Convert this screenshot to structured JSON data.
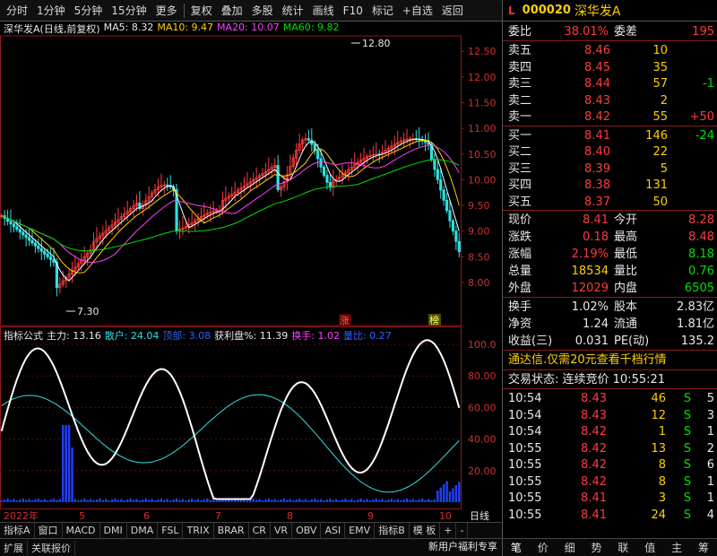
{
  "toolbar": {
    "items": [
      "分时",
      "1分钟",
      "5分钟",
      "15分钟",
      "更多",
      "复权",
      "叠加",
      "多股",
      "统计",
      "画线",
      "F10",
      "标记",
      "+自选",
      "返回"
    ]
  },
  "stock": {
    "flag": "L",
    "code": "000020",
    "name": "深华发A"
  },
  "main_legend": {
    "title": "深华发A(日线,前复权)",
    "ma5": "MA5: 8.32",
    "ma10": "MA10: 9.47",
    "ma20": "MA20: 10.07",
    "ma60": "MA60: 9.82"
  },
  "main_axis": {
    "labels": [
      "12.50",
      "12.00",
      "11.50",
      "11.00",
      "10.50",
      "10.00",
      "9.50",
      "9.00",
      "8.50",
      "8.00"
    ]
  },
  "annotations": {
    "high": "12.80",
    "low": "7.30",
    "tag1": "涨",
    "tag2": "榜"
  },
  "ind_legend": {
    "title": "指标公式",
    "zhuli": "主力: 13.16",
    "sanhu": "散户: 24.04",
    "dingbu": "顶部: 3.08",
    "huolipan": "获利盘%: 11.39",
    "huanshou": "换手: 1.02",
    "liangbi": "量比: 0.27"
  },
  "ind_axis": {
    "labels": [
      "100.0",
      "80.00",
      "60.00",
      "40.00",
      "20.00"
    ]
  },
  "xaxis": {
    "labels": [
      "2022年",
      "5",
      "6",
      "7",
      "8",
      "9",
      "10"
    ],
    "right": "日线"
  },
  "bottom_tabs": [
    "指标A",
    "窗口",
    "MACD",
    "DMI",
    "DMA",
    "FSL",
    "TRIX",
    "BRAR",
    "CR",
    "VR",
    "OBV",
    "ASI",
    "EMV",
    "指标B",
    "模 板",
    "+",
    "-"
  ],
  "bottom_bar": [
    "扩展",
    "关联报价"
  ],
  "quote": {
    "weibi_label": "委比",
    "weibi": "38.01%",
    "weicha_label": "委差",
    "weicha": "195",
    "asks": [
      {
        "label": "卖五",
        "price": "8.46",
        "vol": "10",
        "chg": ""
      },
      {
        "label": "卖四",
        "price": "8.45",
        "vol": "35",
        "chg": ""
      },
      {
        "label": "卖三",
        "price": "8.44",
        "vol": "57",
        "chg": "-1"
      },
      {
        "label": "卖二",
        "price": "8.43",
        "vol": "2",
        "chg": ""
      },
      {
        "label": "卖一",
        "price": "8.42",
        "vol": "55",
        "chg": "+50"
      }
    ],
    "bids": [
      {
        "label": "买一",
        "price": "8.41",
        "vol": "146",
        "chg": "-24"
      },
      {
        "label": "买二",
        "price": "8.40",
        "vol": "22",
        "chg": ""
      },
      {
        "label": "买三",
        "price": "8.39",
        "vol": "5",
        "chg": ""
      },
      {
        "label": "买四",
        "price": "8.38",
        "vol": "131",
        "chg": ""
      },
      {
        "label": "买五",
        "price": "8.37",
        "vol": "50",
        "chg": ""
      }
    ],
    "stats": [
      {
        "l1": "现价",
        "v1": "8.41",
        "l2": "今开",
        "v2": "8.28",
        "c1": "red",
        "c2": "red"
      },
      {
        "l1": "涨跌",
        "v1": "0.18",
        "l2": "最高",
        "v2": "8.48",
        "c1": "red",
        "c2": "red"
      },
      {
        "l1": "涨幅",
        "v1": "2.19%",
        "l2": "最低",
        "v2": "8.18",
        "c1": "red",
        "c2": "grn"
      },
      {
        "l1": "总量",
        "v1": "18534",
        "l2": "量比",
        "v2": "0.76",
        "c1": "yel",
        "c2": "grn"
      },
      {
        "l1": "外盘",
        "v1": "12029",
        "l2": "内盘",
        "v2": "6505",
        "c1": "red",
        "c2": "grn"
      }
    ],
    "stats2": [
      {
        "l1": "换手",
        "v1": "1.02%",
        "l2": "股本",
        "v2": "2.83亿"
      },
      {
        "l1": "净资",
        "v1": "1.24",
        "l2": "流通",
        "v2": "1.81亿"
      },
      {
        "l1": "收益(三)",
        "v1": "0.031",
        "l2": "PE(动)",
        "v2": "135.2"
      }
    ],
    "promo": "通达信.仅需20元查看千档行情",
    "trade_status": "交易状态: 连续竞价  10:55:21",
    "ticks": [
      {
        "t": "10:54",
        "p": "8.43",
        "v": "46",
        "d": "S",
        "n": "5"
      },
      {
        "t": "10:54",
        "p": "8.43",
        "v": "12",
        "d": "S",
        "n": "3"
      },
      {
        "t": "10:54",
        "p": "8.42",
        "v": "1",
        "d": "S",
        "n": "1"
      },
      {
        "t": "10:55",
        "p": "8.42",
        "v": "13",
        "d": "S",
        "n": "2"
      },
      {
        "t": "10:55",
        "p": "8.42",
        "v": "8",
        "d": "S",
        "n": "6"
      },
      {
        "t": "10:55",
        "p": "8.42",
        "v": "8",
        "d": "S",
        "n": "1"
      },
      {
        "t": "10:55",
        "p": "8.41",
        "v": "3",
        "d": "S",
        "n": "1"
      },
      {
        "t": "10:55",
        "p": "8.41",
        "v": "24",
        "d": "S",
        "n": "4"
      }
    ],
    "tabs": [
      "笔",
      "价",
      "细",
      "势",
      "联",
      "值",
      "主",
      "筹"
    ],
    "promo2": "新用户福利专享"
  }
}
